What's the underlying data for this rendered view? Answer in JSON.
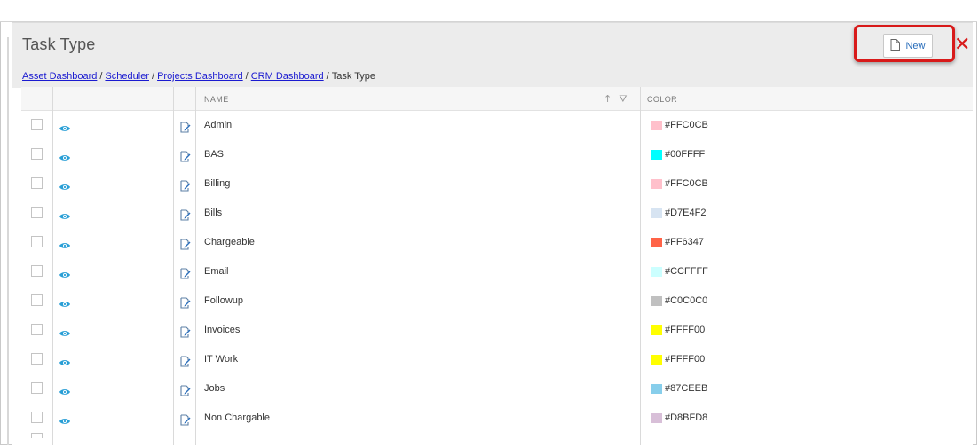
{
  "page": {
    "title": "Task Type"
  },
  "breadcrumb": {
    "items": [
      "Asset Dashboard",
      "Scheduler",
      "Projects Dashboard",
      "CRM Dashboard"
    ],
    "separator": "/",
    "current": "Task Type"
  },
  "toolbar": {
    "new_label": "New",
    "close_glyph": "✕",
    "highlight_color": "#d81a1a"
  },
  "grid": {
    "columns": [
      {
        "key": "select",
        "label": ""
      },
      {
        "key": "view",
        "label": ""
      },
      {
        "key": "edit",
        "label": ""
      },
      {
        "key": "name",
        "label": "NAME"
      },
      {
        "key": "color",
        "label": "COLOR"
      }
    ],
    "sort_glyph": "↑",
    "filter_glyph": "⛛",
    "rows": [
      {
        "name": "Admin",
        "color": "#FFC0CB",
        "color_label": "#FFC0CB"
      },
      {
        "name": "BAS",
        "color": "#00FFFF",
        "color_label": "#00FFFF"
      },
      {
        "name": "Billing",
        "color": "#FFC0CB",
        "color_label": "#FFC0CB"
      },
      {
        "name": "Bills",
        "color": "#D7E4F2",
        "color_label": "#D7E4F2"
      },
      {
        "name": "Chargeable",
        "color": "#FF6347",
        "color_label": "#FF6347"
      },
      {
        "name": "Email",
        "color": "#CCFFFF",
        "color_label": "#CCFFFF"
      },
      {
        "name": "Followup",
        "color": "#C0C0C0",
        "color_label": "#C0C0C0"
      },
      {
        "name": "Invoices",
        "color": "#FFFF00",
        "color_label": "#FFFF00"
      },
      {
        "name": "IT Work",
        "color": "#FFFF00",
        "color_label": "#FFFF00"
      },
      {
        "name": "Jobs",
        "color": "#87CEEB",
        "color_label": "#87CEEB"
      },
      {
        "name": "Non Chargable",
        "color": "#D8BFD8",
        "color_label": "#D8BFD8"
      }
    ]
  },
  "colors": {
    "accent": "#2a9fd6",
    "link": "#1a1ad0",
    "header_band": "#ececec"
  }
}
